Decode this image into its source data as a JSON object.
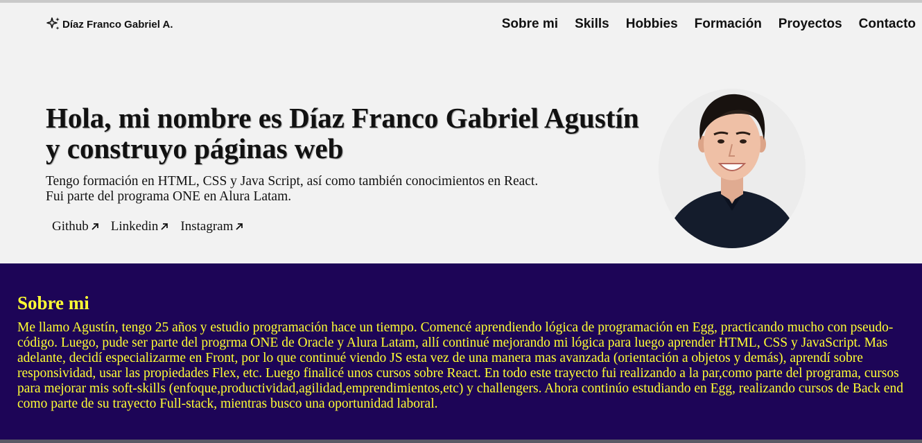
{
  "header": {
    "brand": "Díaz Franco Gabriel A.",
    "brand_icon": "sparkle-icon",
    "nav": [
      {
        "label": "Sobre mi"
      },
      {
        "label": "Skills"
      },
      {
        "label": "Hobbies"
      },
      {
        "label": "Formación"
      },
      {
        "label": "Proyectos"
      },
      {
        "label": "Contacto"
      }
    ]
  },
  "hero": {
    "title": "Hola, mi nombre es Díaz Franco Gabriel Agustín y construyo páginas web",
    "description_line1": "Tengo formación en HTML, CSS y Java Script, así como también conocimientos en React.",
    "description_line2": "Fui parte del programa ONE en Alura Latam.",
    "links": [
      {
        "label": "Github",
        "icon": "arrow-up-right-icon"
      },
      {
        "label": "Linkedin",
        "icon": "arrow-up-right-icon"
      },
      {
        "label": "Instagram",
        "icon": "arrow-up-right-icon"
      }
    ]
  },
  "about": {
    "title": "Sobre mi",
    "text": "Me llamo Agustín, tengo 25 años y estudio programación hace un tiempo. Comencé aprendiendo lógica de programación en Egg, practicando mucho con pseudo-código. Luego, pude ser parte del progrma ONE de Oracle y Alura Latam, allí continué mejorando mi lógica para luego aprender HTML, CSS y JavaScript. Mas adelante, decidí especializarme en Front, por lo que continué viendo JS esta vez de una manera mas avanzada (orientación a objetos y demás), aprendí sobre responsividad, usar las propiedades Flex, etc. Luego finalicé unos cursos sobre React. En todo este trayecto fui realizando a la par,como parte del programa, cursos para mejorar mis soft-skills (enfoque,productividad,agilidad,emprendimientos,etc) y challengers. Ahora continúo estudiando en Egg, realizando cursos de Back end como parte de su trayecto Full-stack, mientras busco una oportunidad laboral."
  },
  "colors": {
    "page_background": "#f2f2f2",
    "about_background": "#1d0557",
    "about_text": "#ffff33"
  }
}
